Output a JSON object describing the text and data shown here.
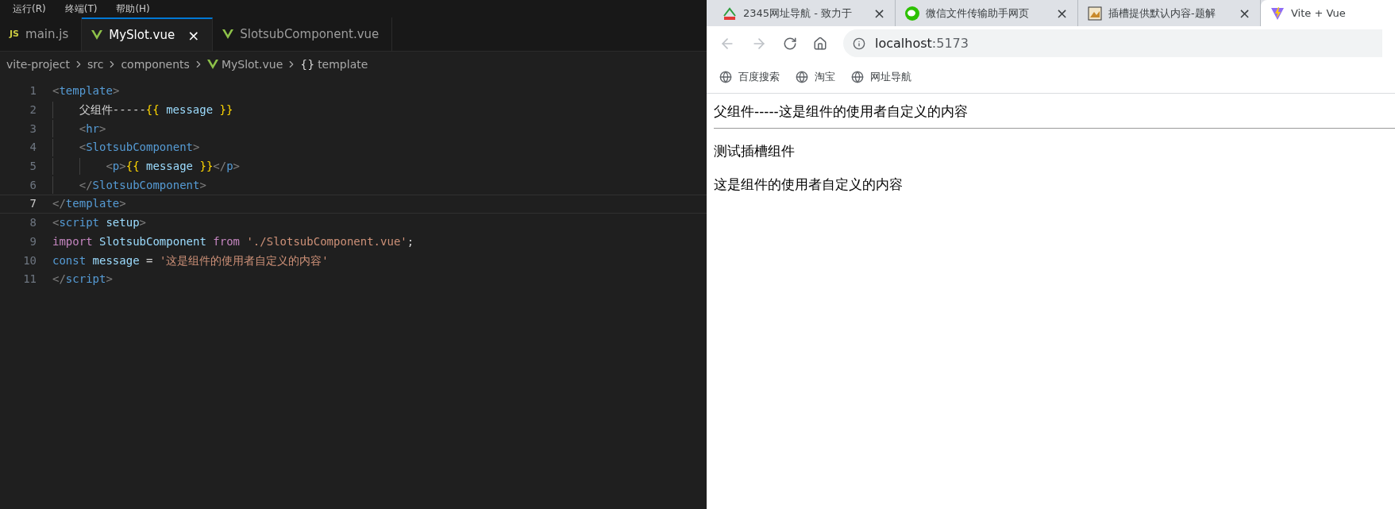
{
  "menu_bar": {
    "items": [
      "运行(R)",
      "终端(T)",
      "帮助(H)"
    ]
  },
  "editor_tabs": [
    {
      "label": "main.js",
      "kind": "js",
      "badge": "JS",
      "selected": false
    },
    {
      "label": "MySlot.vue",
      "kind": "vue",
      "selected": true,
      "close": "×"
    },
    {
      "label": "SlotsubComponent.vue",
      "kind": "vue",
      "selected": false
    }
  ],
  "breadcrumb": [
    {
      "label": "vite-project",
      "kind": "folder"
    },
    {
      "label": "src",
      "kind": "folder"
    },
    {
      "label": "components",
      "kind": "folder"
    },
    {
      "label": "MySlot.vue",
      "kind": "vue"
    },
    {
      "label": "template",
      "kind": "symbol",
      "badge": "{}"
    }
  ],
  "code_lines": [
    {
      "number": "1",
      "current": false,
      "tokens": [
        {
          "kind": "punct",
          "text": "<"
        },
        {
          "kind": "tag",
          "text": "template"
        },
        {
          "kind": "punct",
          "text": ">"
        }
      ]
    },
    {
      "number": "2",
      "current": false,
      "tokens": [
        {
          "kind": "text",
          "text": "    父组件-----"
        },
        {
          "kind": "brace",
          "text": "{{"
        },
        {
          "kind": "var",
          "text": " message "
        },
        {
          "kind": "brace",
          "text": "}}"
        }
      ]
    },
    {
      "number": "3",
      "current": false,
      "tokens": [
        {
          "kind": "punct",
          "text": "    <"
        },
        {
          "kind": "tag",
          "text": "hr"
        },
        {
          "kind": "punct",
          "text": ">"
        }
      ]
    },
    {
      "number": "4",
      "current": false,
      "tokens": [
        {
          "kind": "punct",
          "text": "    <"
        },
        {
          "kind": "tag",
          "text": "SlotsubComponent"
        },
        {
          "kind": "punct",
          "text": ">"
        }
      ]
    },
    {
      "number": "5",
      "current": false,
      "tokens": [
        {
          "kind": "punct",
          "text": "        <"
        },
        {
          "kind": "tag",
          "text": "p"
        },
        {
          "kind": "punct",
          "text": ">"
        },
        {
          "kind": "brace",
          "text": "{{"
        },
        {
          "kind": "var",
          "text": " message "
        },
        {
          "kind": "brace",
          "text": "}}"
        },
        {
          "kind": "punct",
          "text": "</"
        },
        {
          "kind": "tag",
          "text": "p"
        },
        {
          "kind": "punct",
          "text": ">"
        }
      ]
    },
    {
      "number": "6",
      "current": false,
      "tokens": [
        {
          "kind": "punct",
          "text": "    </"
        },
        {
          "kind": "tag",
          "text": "SlotsubComponent"
        },
        {
          "kind": "punct",
          "text": ">"
        }
      ]
    },
    {
      "number": "7",
      "current": true,
      "tokens": [
        {
          "kind": "punct",
          "text": "</"
        },
        {
          "kind": "tag",
          "text": "template"
        },
        {
          "kind": "punct",
          "text": ">"
        }
      ]
    },
    {
      "number": "8",
      "current": false,
      "tokens": [
        {
          "kind": "punct",
          "text": "<"
        },
        {
          "kind": "tag",
          "text": "script"
        },
        {
          "kind": "attr",
          "text": " setup"
        },
        {
          "kind": "punct",
          "text": ">"
        }
      ]
    },
    {
      "number": "9",
      "current": false,
      "tokens": [
        {
          "kind": "keyword",
          "text": "import"
        },
        {
          "kind": "var",
          "text": " SlotsubComponent "
        },
        {
          "kind": "keyword",
          "text": "from"
        },
        {
          "kind": "string",
          "text": " './SlotsubComponent.vue'"
        },
        {
          "kind": "text",
          "text": ";"
        }
      ]
    },
    {
      "number": "10",
      "current": false,
      "tokens": [
        {
          "kind": "storage",
          "text": "const"
        },
        {
          "kind": "var",
          "text": " message"
        },
        {
          "kind": "text",
          "text": " = "
        },
        {
          "kind": "string",
          "text": "'这是组件的使用者自定义的内容'"
        }
      ]
    },
    {
      "number": "11",
      "current": false,
      "tokens": [
        {
          "kind": "punct",
          "text": "</"
        },
        {
          "kind": "tag",
          "text": "script"
        },
        {
          "kind": "punct",
          "text": ">"
        }
      ]
    }
  ],
  "browser_tabs": [
    {
      "label": "2345网址导航 - 致力于",
      "kind": "site",
      "selected": false,
      "close": "×"
    },
    {
      "label": "微信文件传输助手网页",
      "kind": "chat",
      "selected": false,
      "close": "×"
    },
    {
      "label": "插槽提供默认内容-题解",
      "kind": "picture",
      "selected": false,
      "close": "×"
    },
    {
      "label": "Vite + Vue",
      "kind": "vite",
      "selected": true
    }
  ],
  "address": {
    "host": "localhost",
    "port": ":5173"
  },
  "bookmarks": [
    "百度搜索",
    "淘宝",
    "网址导航"
  ],
  "page": [
    {
      "kind": "text",
      "text": "父组件-----这是组件的使用者自定义的内容"
    },
    {
      "kind": "rule"
    },
    {
      "kind": "para",
      "text": "测试插槽组件"
    },
    {
      "kind": "para",
      "text": "这是组件的使用者自定义的内容"
    }
  ]
}
